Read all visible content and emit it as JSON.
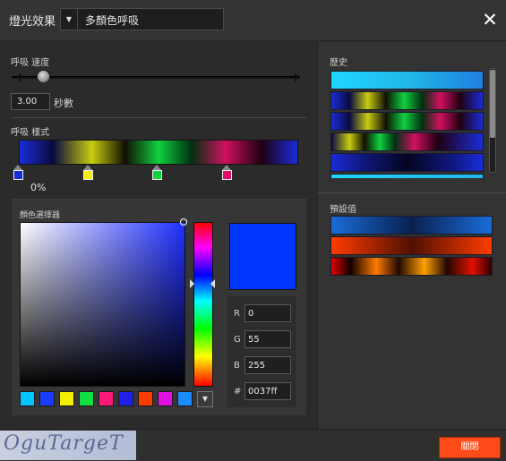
{
  "header": {
    "title": "燈光效果",
    "dropdown_arrow": "▼",
    "dropdown_value": "多顏色呼吸",
    "close_glyph": "✕"
  },
  "breath_speed": {
    "label": "呼吸 速度",
    "value": "3.00",
    "unit": "秒數",
    "slider_level": 0.09
  },
  "breath_style": {
    "label": "呼吸 樣式",
    "stop_colors": [
      "#1a2cd8",
      "#f0f000",
      "#10d040",
      "#e0106a"
    ],
    "selected_stop_percent": "0%"
  },
  "color_picker": {
    "label": "顏色選擇器",
    "preview_color": "#0037ff",
    "rgb": {
      "r_label": "R",
      "r_value": "0",
      "g_label": "G",
      "g_value": "55",
      "b_label": "B",
      "b_value": "255",
      "hex_label": "#",
      "hex_value": "0037ff"
    },
    "swatches": [
      "#00c8ff",
      "#1a3cff",
      "#f0f000",
      "#10e040",
      "#ff1a7a",
      "#2020e8",
      "#ff3c00",
      "#e010e0",
      "#1a8cff"
    ],
    "more_glyph": "▼"
  },
  "history": {
    "label": "歷史"
  },
  "presets": {
    "label": "預設值"
  },
  "footer": {
    "watermark": "OguTargeT",
    "close_button": "關閉"
  },
  "colors": {
    "accent": "#ff4a1a",
    "background": "#2d2d2d"
  }
}
